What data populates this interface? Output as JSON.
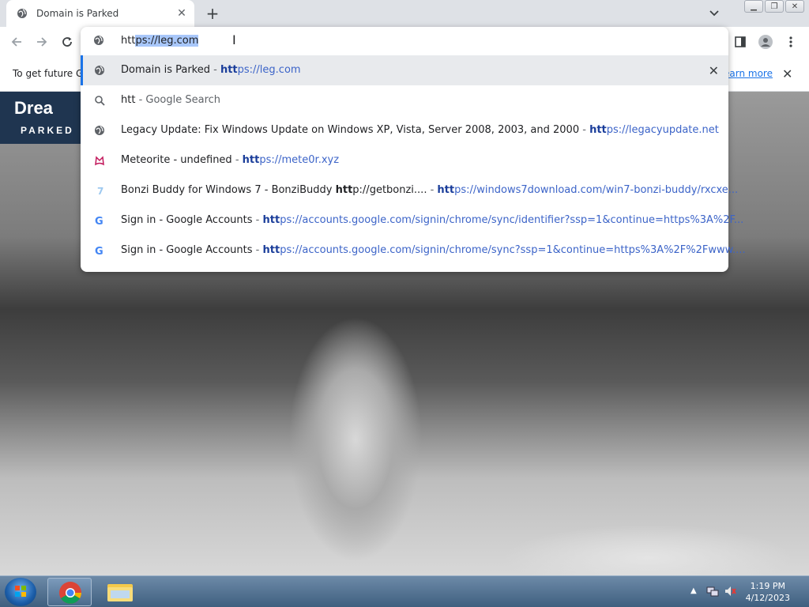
{
  "tab": {
    "title": "Domain is Parked",
    "favicon": "globe-icon"
  },
  "toolbar": {
    "back": "back-arrow-icon",
    "forward": "forward-arrow-icon",
    "reload": "reload-icon"
  },
  "omnibox": {
    "typed": "htt",
    "completion": "ps://leg.com",
    "suggestions": [
      {
        "icon": "globe-icon",
        "title": "Domain is Parked",
        "sep": " - ",
        "url_bold": "htt",
        "url_rest": "ps://leg.com",
        "selected": true
      },
      {
        "icon": "search-icon",
        "title": "htt",
        "sep": " - ",
        "hint": "Google Search"
      },
      {
        "icon": "globe-icon",
        "title": "Legacy Update: Fix Windows Update on Windows XP, Vista, Server 2008, 2003, and 2000",
        "sep": " - ",
        "url_bold": "htt",
        "url_rest": "ps://legacyupdate.net"
      },
      {
        "icon": "meteorite-icon",
        "title": "Meteorite - undefined",
        "sep": " - ",
        "url_bold": "htt",
        "url_rest": "ps://mete0r.xyz"
      },
      {
        "icon": "windows7-icon",
        "title_pre": "Bonzi Buddy for Windows 7 - BonziBuddy ",
        "title_bold": "htt",
        "title_post": "p://getbonzi....",
        "sep": "  - ",
        "url_bold": "htt",
        "url_rest": "ps://windows7download.com/win7-bonzi-buddy/rxcxe..."
      },
      {
        "icon": "google-icon",
        "title": "Sign in - Google Accounts",
        "sep": " - ",
        "url_bold": "htt",
        "url_rest": "ps://accounts.google.com/signin/chrome/sync/identifier?ssp=1&continue=https%3A%2F..."
      },
      {
        "icon": "google-icon",
        "title": "Sign in - Google Accounts",
        "sep": " - ",
        "url_bold": "htt",
        "url_rest": "ps://accounts.google.com/signin/chrome/sync?ssp=1&continue=https%3A%2F%2Fwww...."
      }
    ]
  },
  "infobar": {
    "text": "To get future G",
    "learn_more": "earn more"
  },
  "brand": {
    "line1": "Drea",
    "line2": "PARKED"
  },
  "taskbar": {
    "time": "1:19 PM",
    "date": "4/12/2023"
  }
}
